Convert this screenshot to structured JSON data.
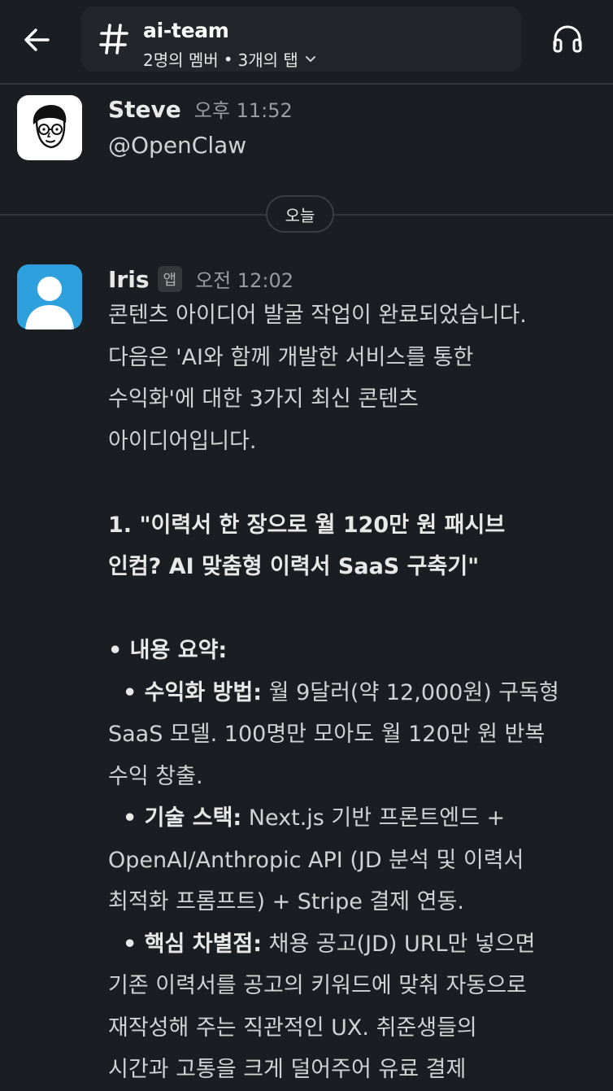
{
  "header": {
    "channel_name": "ai-team",
    "members": "2명의 멤버",
    "separator": "•",
    "tabs": "3개의 탭"
  },
  "messages": [
    {
      "sender": "Steve",
      "time": "오후 11:52",
      "text": "@OpenClaw"
    },
    {
      "sender": "Iris",
      "badge": "앱",
      "time": "오전 12:02",
      "lines": [
        "콘텐츠 아이디어 발굴 작업이 완료되었습니다.",
        "다음은 'AI와 함께 개발한 서비스를 통한",
        "수익화'에 대한 3가지 최신 콘텐츠",
        "아이디어입니다.",
        "",
        "1. \"이력서 한 장으로 월 120만 원 패시브",
        "인컴? AI 맞춤형 이력서 SaaS 구축기\"",
        "",
        "• 내용 요약:",
        "• 수익화 방법:",
        " 월 9달러(약 12,000원) 구독형",
        "SaaS 모델. 100명만 모아도 월 120만 원 반복",
        "수익 창출.",
        "• 기술 스택:",
        " Next.js 기반 프론트엔드 +",
        "OpenAI/Anthropic API (JD 분석 및 이력서",
        "최적화 프롬프트) + Stripe 결제 연동.",
        "• 핵심 차별점:",
        " 채용 공고(JD) URL만 넣으면",
        "기존 이력서를 공고의 키워드에 맞춰 자동으로",
        "재작성해 주는 직관적인 UX. 취준생들의",
        "시간과 고통을 크게 덜어주어 유료 결제"
      ]
    }
  ],
  "date_divider": "오늘",
  "colors": {
    "background": "#1a1d21",
    "pill": "#222529",
    "avatar_iris": "#2ea0dd",
    "text": "#d1d2d3",
    "muted": "#9b9c9e"
  },
  "icons": {
    "back": "arrow-left-icon",
    "channel": "hash-icon",
    "dropdown": "chevron-down-icon",
    "huddle": "headphones-icon"
  }
}
